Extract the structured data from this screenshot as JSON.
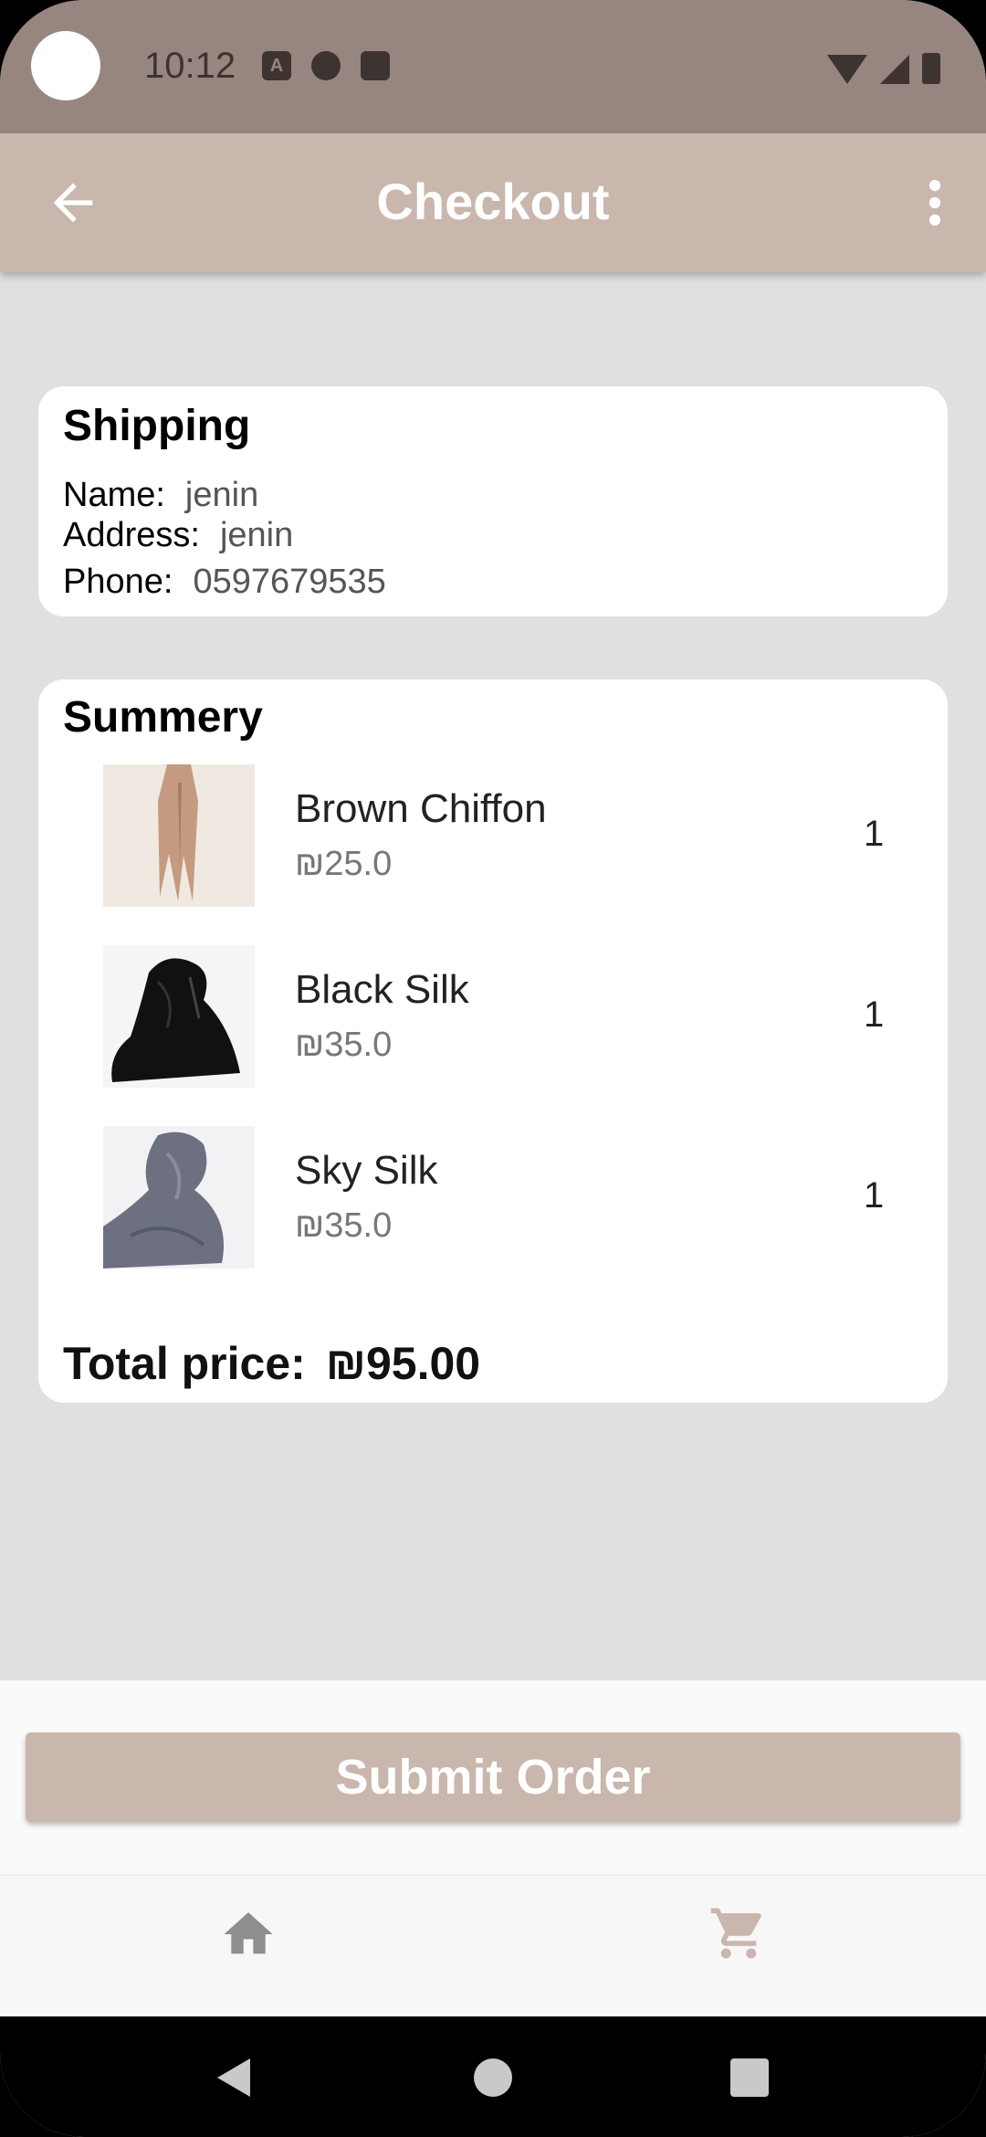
{
  "status_bar": {
    "time": "10:12",
    "icons_left": [
      "font-icon",
      "circle-app-icon",
      "sd-card-icon"
    ],
    "icons_right": [
      "wifi-icon",
      "signal-icon",
      "battery-icon"
    ]
  },
  "app_bar": {
    "title": "Checkout",
    "back_icon": "arrow-back-icon",
    "menu_icon": "more-vert-icon",
    "color": "#c9b6ac"
  },
  "shipping": {
    "title": "Shipping",
    "name_label": "Name:",
    "name_value": "jenin",
    "address_label": "Address:",
    "address_value": "jenin",
    "phone_label": "Phone:",
    "phone_value": "0597679535"
  },
  "summary": {
    "title": "Summery",
    "items": [
      {
        "name": "Brown Chiffon",
        "price": "₪25.0",
        "qty": "1"
      },
      {
        "name": "Black Silk",
        "price": "₪35.0",
        "qty": "1"
      },
      {
        "name": "Sky Silk",
        "price": "₪35.0",
        "qty": "1"
      }
    ],
    "total_label": "Total price:",
    "total_value": "₪95.00"
  },
  "submit_label": "Submit Order",
  "bottom_nav": {
    "items": [
      {
        "icon": "home-icon",
        "active": false
      },
      {
        "icon": "cart-icon",
        "active": true
      }
    ]
  },
  "colors": {
    "accent": "#c9b6ac",
    "status_bar": "#978580",
    "background": "#e0e0e0"
  }
}
